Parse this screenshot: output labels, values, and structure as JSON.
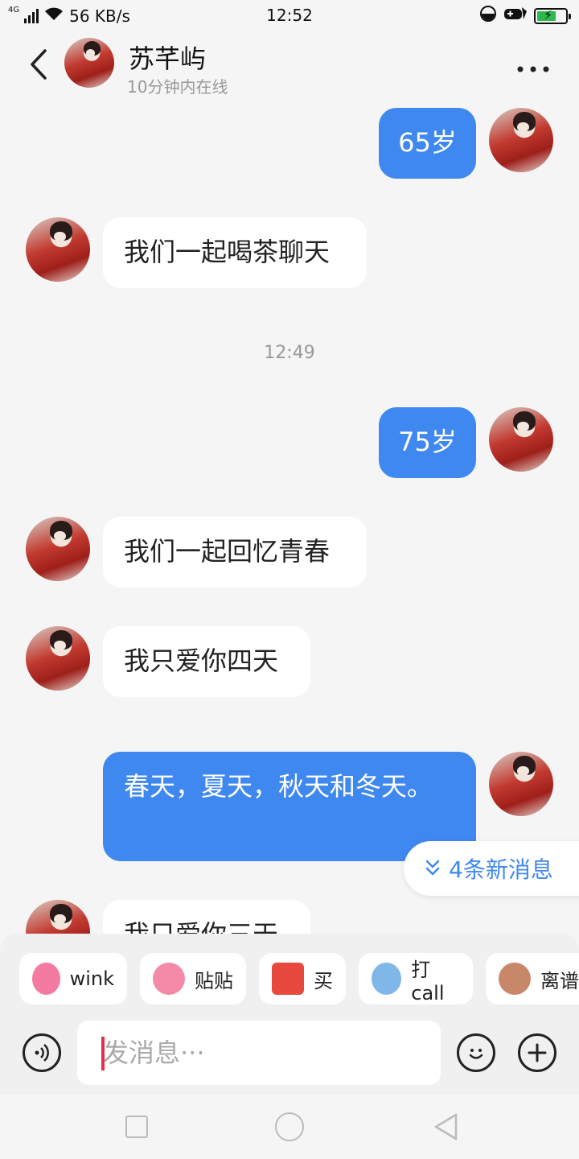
{
  "status_bar": {
    "network_type": "4G",
    "speed": "56 KB/s",
    "time": "12:52",
    "icons": [
      "signal-icon",
      "wifi-icon",
      "alarm-icon",
      "gamepad-icon",
      "battery-charging-icon"
    ]
  },
  "header": {
    "back_icon": "chevron-left-icon",
    "contact_name": "苏芊屿",
    "status": "10分钟内在线",
    "more_icon": "more-icon"
  },
  "messages": [
    {
      "side": "out",
      "text": "65岁"
    },
    {
      "side": "in",
      "text": "我们一起喝茶聊天"
    },
    {
      "type": "time",
      "text": "12:49"
    },
    {
      "side": "out",
      "text": "75岁"
    },
    {
      "side": "in",
      "text": "我们一起回忆青春"
    },
    {
      "side": "in",
      "text": "我只爱你四天"
    },
    {
      "side": "out",
      "text": "春天，夏天，秋天和冬天。"
    },
    {
      "side": "in",
      "text": "我只爱你三天"
    }
  ],
  "new_messages": {
    "label": "4条新消息",
    "icon": "double-chevron-down-icon"
  },
  "stickers": [
    {
      "label": "wink",
      "icon": "wink-sticker-icon",
      "color": "#f37aa0"
    },
    {
      "label": "贴贴",
      "icon": "hug-sticker-icon",
      "color": "#f58aa8"
    },
    {
      "label": "买",
      "icon": "buy-sticker-icon",
      "color": "#e8493f"
    },
    {
      "label": "打call",
      "icon": "call-sticker-icon",
      "color": "#7fb8e8"
    },
    {
      "label": "离谱",
      "icon": "shocked-sticker-icon",
      "color": "#c9876a"
    }
  ],
  "composer": {
    "placeholder": "发消息···",
    "voice_icon": "voice-icon",
    "emoji_icon": "emoji-icon",
    "plus_icon": "plus-icon"
  },
  "colors": {
    "accent": "#3f88f0",
    "background": "#f5f5f5",
    "bubble_in": "#ffffff"
  }
}
